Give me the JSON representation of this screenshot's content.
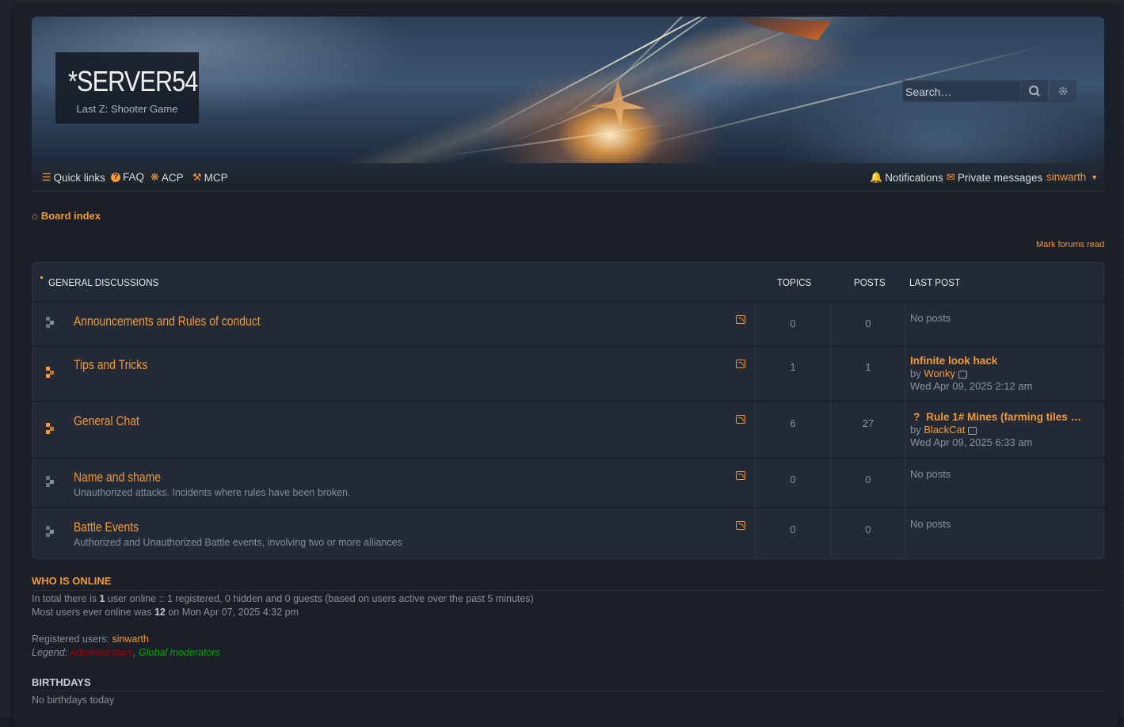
{
  "header": {
    "site_title": "*SERVER54",
    "site_subtitle": "Last Z: Shooter Game",
    "search_placeholder": "Search…"
  },
  "navbar": {
    "quick_links": "Quick links",
    "faq": "FAQ",
    "acp": "ACP",
    "mcp": "MCP",
    "notifications": "Notifications",
    "private_messages": "Private messages",
    "username": "sinwarth"
  },
  "breadcrumb": {
    "board_index": "Board index"
  },
  "mark_forums_read": "Mark forums read",
  "forum_table": {
    "category": "GENERAL DISCUSSIONS",
    "col_topics": "TOPICS",
    "col_posts": "POSTS",
    "col_last_post": "LAST POST",
    "forums": [
      {
        "title": "Announcements and Rules of conduct",
        "description": "",
        "topics": "0",
        "posts": "0",
        "no_posts": "No posts"
      },
      {
        "title": "Tips and Tricks",
        "description": "",
        "topics": "1",
        "posts": "1",
        "last_title": "Infinite look hack",
        "last_by": "by",
        "last_user": "Wonky",
        "last_date": "Wed Apr 09, 2025 2:12 am"
      },
      {
        "title": "General Chat",
        "description": "",
        "topics": "6",
        "posts": "27",
        "last_title": "Rule 1# Mines (farming tiles …",
        "last_by": "by",
        "last_user": "BlackCat",
        "last_date": "Wed Apr 09, 2025 6:33 am"
      },
      {
        "title": "Name and shame",
        "description": "Unauthorized attacks. Incidents where rules have been broken.",
        "topics": "0",
        "posts": "0",
        "no_posts": "No posts"
      },
      {
        "title": "Battle Events",
        "description": "Authorized and Unauthorized Battle events, involving two or more alliances",
        "topics": "0",
        "posts": "0",
        "no_posts": "No posts"
      }
    ]
  },
  "who_is_online": {
    "title": "WHO IS ONLINE",
    "line1_pre": "In total there is ",
    "line1_count": "1",
    "line1_post": " user online :: 1 registered, 0 hidden and 0 guests (based on users active over the past 5 minutes)",
    "line2_pre": "Most users ever online was ",
    "line2_count": "12",
    "line2_post": " on Mon Apr 07, 2025 4:32 pm",
    "registered_label": "Registered users: ",
    "registered_user": "sinwarth",
    "legend_label": "Legend: ",
    "legend_admins": "Administrators",
    "legend_sep": ", ",
    "legend_mods": "Global moderators"
  },
  "birthdays": {
    "title": "BIRTHDAYS",
    "text": "No birthdays today"
  },
  "colors": {
    "accent": "#f29a38",
    "admin": "#aa0000",
    "moderator": "#00aa00",
    "panel": "#232a35"
  }
}
